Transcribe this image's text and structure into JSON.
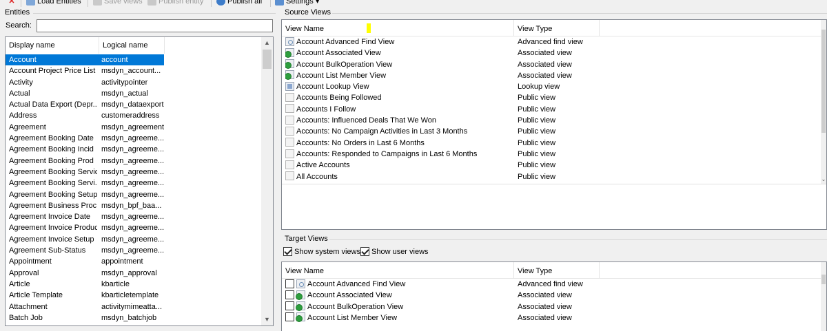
{
  "toolbar": {
    "items": [
      {
        "label": "",
        "icon": "close-icon",
        "enabled": true
      },
      {
        "label": "Load Entities",
        "icon": "load-icon",
        "enabled": true
      },
      {
        "label": "Save views",
        "icon": "save-icon",
        "enabled": false
      },
      {
        "label": "Publish entity",
        "icon": "publish-entity-icon",
        "enabled": false
      },
      {
        "label": "Publish all",
        "icon": "publish-all-icon",
        "enabled": true
      },
      {
        "label": "Settings",
        "icon": "settings-icon",
        "enabled": true
      }
    ],
    "settings_caret": "▾"
  },
  "entities": {
    "group_title": "Entities",
    "search_label": "Search:",
    "search_value": "",
    "columns": [
      "Display name",
      "Logical name"
    ],
    "rows": [
      {
        "display": "Account",
        "logical": "account",
        "selected": true
      },
      {
        "display": "Account Project Price List",
        "logical": "msdyn_account..."
      },
      {
        "display": "Activity",
        "logical": "activitypointer"
      },
      {
        "display": "Actual",
        "logical": "msdyn_actual"
      },
      {
        "display": "Actual Data Export (Depr...",
        "logical": "msdyn_dataexport"
      },
      {
        "display": "Address",
        "logical": "customeraddress"
      },
      {
        "display": "Agreement",
        "logical": "msdyn_agreement"
      },
      {
        "display": "Agreement Booking Date",
        "logical": "msdyn_agreeme..."
      },
      {
        "display": "Agreement Booking Incid",
        "logical": "msdyn_agreeme..."
      },
      {
        "display": "Agreement Booking Prod",
        "logical": "msdyn_agreeme..."
      },
      {
        "display": "Agreement Booking Service",
        "logical": "msdyn_agreeme..."
      },
      {
        "display": "Agreement Booking Servi...",
        "logical": "msdyn_agreeme..."
      },
      {
        "display": "Agreement Booking Setup",
        "logical": "msdyn_agreeme..."
      },
      {
        "display": "Agreement Business Proc",
        "logical": "msdyn_bpf_baa..."
      },
      {
        "display": "Agreement Invoice Date",
        "logical": "msdyn_agreeme..."
      },
      {
        "display": "Agreement Invoice Product",
        "logical": "msdyn_agreeme..."
      },
      {
        "display": "Agreement Invoice Setup",
        "logical": "msdyn_agreeme..."
      },
      {
        "display": "Agreement Sub-Status",
        "logical": "msdyn_agreeme..."
      },
      {
        "display": "Appointment",
        "logical": "appointment"
      },
      {
        "display": "Approval",
        "logical": "msdyn_approval"
      },
      {
        "display": "Article",
        "logical": "kbarticle"
      },
      {
        "display": "Article Template",
        "logical": "kbarticletemplate"
      },
      {
        "display": "Attachment",
        "logical": "activitymimeatta..."
      },
      {
        "display": "Batch Job",
        "logical": "msdyn_batchjob"
      }
    ]
  },
  "source_views": {
    "group_title": "Source Views",
    "columns": [
      "View Name",
      "View Type"
    ],
    "rows": [
      {
        "name": "Account Advanced Find View",
        "type": "Advanced find view",
        "icon": "advanced-find-view-icon"
      },
      {
        "name": "Account Associated View",
        "type": "Associated view",
        "icon": "associated-view-icon"
      },
      {
        "name": "Account BulkOperation View",
        "type": "Associated view",
        "icon": "associated-view-icon"
      },
      {
        "name": "Account List Member View",
        "type": "Associated view",
        "icon": "associated-view-icon"
      },
      {
        "name": "Account Lookup View",
        "type": "Lookup view",
        "icon": "lookup-view-icon"
      },
      {
        "name": "Accounts Being Followed",
        "type": "Public view",
        "icon": "public-view-icon"
      },
      {
        "name": "Accounts I Follow",
        "type": "Public view",
        "icon": "public-view-icon"
      },
      {
        "name": "Accounts: Influenced Deals That We Won",
        "type": "Public view",
        "icon": "public-view-icon"
      },
      {
        "name": "Accounts: No Campaign Activities in Last 3 Months",
        "type": "Public view",
        "icon": "public-view-icon"
      },
      {
        "name": "Accounts: No Orders in Last 6 Months",
        "type": "Public view",
        "icon": "public-view-icon"
      },
      {
        "name": "Accounts: Responded to Campaigns in Last 6 Months",
        "type": "Public view",
        "icon": "public-view-icon"
      },
      {
        "name": "Active Accounts",
        "type": "Public view",
        "icon": "public-view-icon"
      },
      {
        "name": "All Accounts",
        "type": "Public view",
        "icon": "public-view-icon"
      }
    ]
  },
  "target_views": {
    "group_title": "Target Views",
    "show_system_views": {
      "label": "Show system views",
      "checked": true
    },
    "show_user_views": {
      "label": "Show user views",
      "checked": true
    },
    "columns": [
      "View Name",
      "View Type"
    ],
    "rows": [
      {
        "name": "Account Advanced Find View",
        "type": "Advanced find view",
        "icon": "advanced-find-view-icon"
      },
      {
        "name": "Account Associated View",
        "type": "Associated view",
        "icon": "associated-view-icon"
      },
      {
        "name": "Account BulkOperation View",
        "type": "Associated view",
        "icon": "associated-view-icon"
      },
      {
        "name": "Account List Member View",
        "type": "Associated view",
        "icon": "associated-view-icon"
      }
    ]
  },
  "colors": {
    "selection": "#0078d7",
    "highlight_marker": "#ffff00"
  }
}
